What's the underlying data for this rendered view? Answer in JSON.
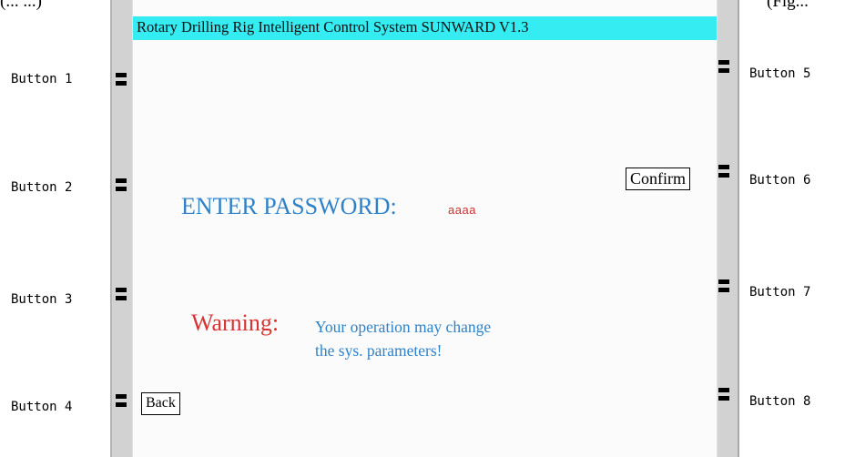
{
  "page": {
    "top_fragment_left": "(... ...)",
    "top_fragment_right": "(Fig..."
  },
  "screen": {
    "title": "Rotary Drilling Rig Intelligent Control System   SUNWARD  V1.3",
    "password_label": "ENTER PASSWORD:",
    "password_value": "aaaa",
    "confirm_label": "Confirm",
    "warning_label": "Warning:",
    "warning_line1": "Your operation may change",
    "warning_line2": "the sys. parameters!",
    "back_label": "Back",
    "header_color": "#35ecf2"
  },
  "hardware_buttons": {
    "left": [
      "Button 1",
      "Button 2",
      "Button 3",
      "Button 4"
    ],
    "right": [
      "Button 5",
      "Button 6",
      "Button 7",
      "Button 8"
    ]
  }
}
